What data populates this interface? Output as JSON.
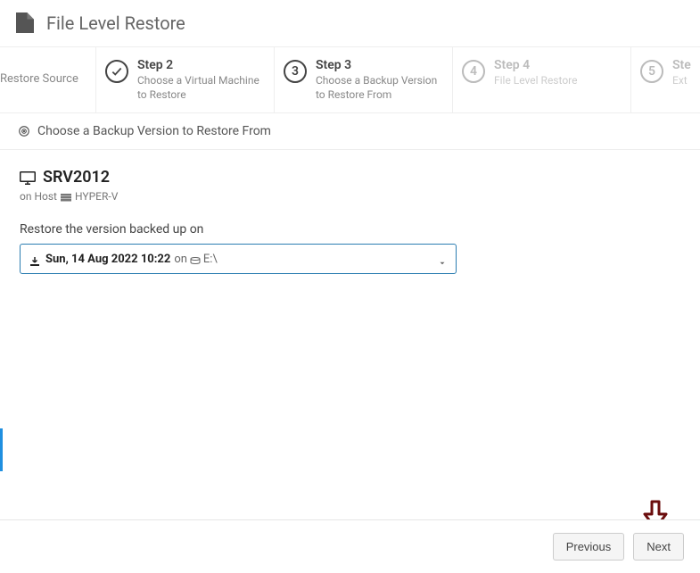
{
  "header": {
    "title": "File Level Restore"
  },
  "steps": {
    "s1": {
      "desc": "Restore Source"
    },
    "s2": {
      "title": "Step 2",
      "desc": "Choose a Virtual Machine to Restore",
      "state": "done"
    },
    "s3": {
      "title": "Step 3",
      "desc": "Choose a Backup Version to Restore From",
      "num": "3",
      "state": "active"
    },
    "s4": {
      "title": "Step 4",
      "desc": "File Level Restore",
      "num": "4",
      "state": "future"
    },
    "s5": {
      "title": "Ste",
      "desc": "Ext",
      "num": "5",
      "state": "future"
    }
  },
  "subheader": {
    "text": "Choose a Backup Version to Restore From"
  },
  "vm": {
    "name": "SRV2012",
    "host_prefix": "on Host",
    "host_name": "HYPER-V"
  },
  "version": {
    "label": "Restore the version backed up on",
    "selected_date": "Sun, 14 Aug 2022 10:22",
    "on_text": "on",
    "drive": "E:\\"
  },
  "footer": {
    "prev": "Previous",
    "next": "Next"
  }
}
